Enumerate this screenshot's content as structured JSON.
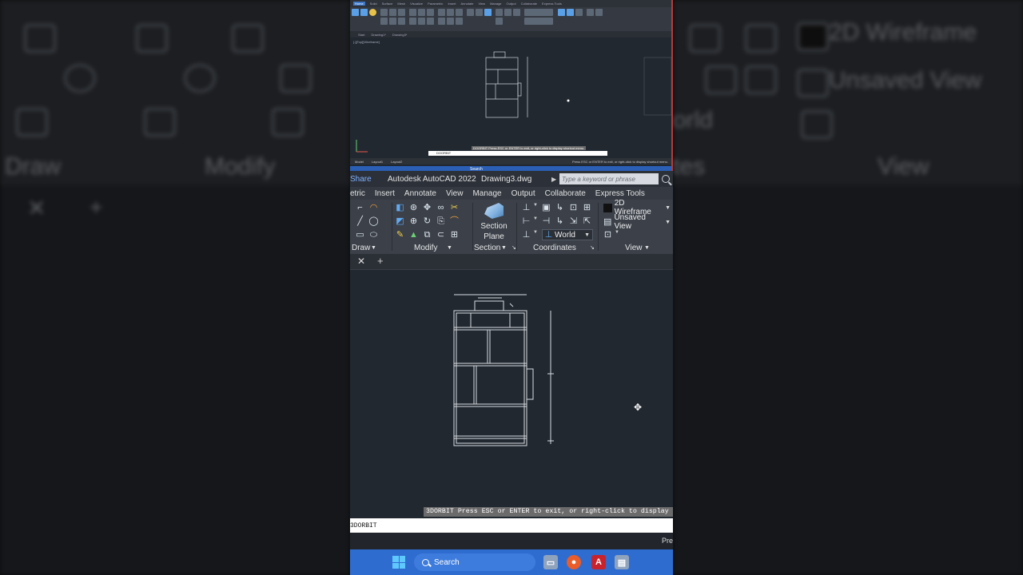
{
  "background": {
    "left_texts": [
      "Draw",
      "Modify"
    ],
    "right_texts": [
      "2D Wireframe",
      "Unsaved View",
      "orld",
      "tes",
      "View"
    ]
  },
  "mini": {
    "tabs": [
      "Home",
      "Solid",
      "Surface",
      "Mesh",
      "Visualize",
      "Parametric",
      "Insert",
      "Annotate",
      "View",
      "Manage",
      "Output",
      "Collaborate",
      "Express Tools"
    ],
    "doc_tabs": [
      "Start",
      "Drawing1*",
      "Drawing3*"
    ],
    "viewport_label": "[-][Top][Wireframe]",
    "command": "DOORBIT",
    "message": "DOORBIT Press ESC or ENTER to exit, or right-click to display shortcut menu.",
    "layout_tabs": [
      "Model",
      "Layout1",
      "Layout2"
    ],
    "status_right": "Press ESC or ENTER to exit, or right-click to display shortcut menu.",
    "taskbar_search": "Search"
  },
  "title_bar": {
    "share": "Share",
    "app": "Autodesk AutoCAD 2022",
    "file": "Drawing3.dwg",
    "search_placeholder": "Type a keyword or phrase"
  },
  "menu_tabs": [
    "etric",
    "Insert",
    "Annotate",
    "View",
    "Manage",
    "Output",
    "Collaborate",
    "Express Tools"
  ],
  "ribbon": {
    "draw_label": "Draw",
    "modify_label": "Modify",
    "section_plane": "Section Plane",
    "section_label": "Section",
    "coordinates_label": "Coordinates",
    "world_value": "World",
    "visual_style": "2D Wireframe",
    "named_view": "Unsaved View",
    "view_label": "View"
  },
  "command": {
    "message": "3DORBIT Press ESC or ENTER to exit, or right-click to display sh",
    "input": "3DORBIT"
  },
  "status_bar": {
    "right_text": "Pre"
  },
  "taskbar": {
    "search_label": "Search"
  },
  "colors": {
    "canvas": "#212830",
    "ribbon": "#3b4049",
    "taskbar": "#2f6cd0",
    "share_link": "#7fb2ff"
  }
}
